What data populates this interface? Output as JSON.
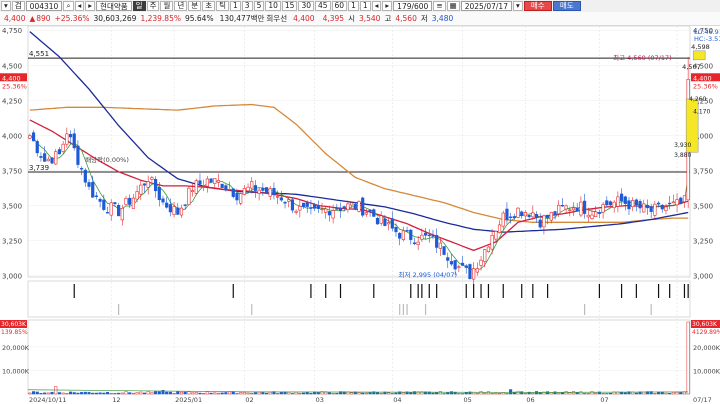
{
  "toolbar": {
    "stock_code": "004310",
    "stock_name": "현대약품",
    "period_buttons": [
      "주",
      "월",
      "년",
      "분",
      "초",
      "틱"
    ],
    "interval_buttons": [
      "1",
      "3",
      "5",
      "10",
      "15",
      "30",
      "45",
      "60"
    ],
    "extra_buttons": [
      "1",
      "1"
    ],
    "bar_count": "179/600",
    "date": "2025/07/17",
    "buy_label": "매수",
    "sell_label": "매도"
  },
  "info": {
    "price": "4,400",
    "change": "890",
    "change_pct": "+25.36%",
    "volume": "30,603,269",
    "volume_pct": "1,239.85%",
    "turnover": "95.64%",
    "amount": "130,477백만",
    "rotation_label": "회우선",
    "close_label": "4,400",
    "field2": "4,395",
    "open_label": "시",
    "open": "3,540",
    "high_label": "고",
    "high": "4,560",
    "low_label": "저",
    "low": "3,480"
  },
  "chart_data": {
    "type": "candlestick",
    "price_axis": {
      "ticks": [
        "4,750",
        "4,500",
        "4,250",
        "4,000",
        "3,750",
        "3,500",
        "3,250",
        "3,000"
      ],
      "range": [
        2990,
        4780
      ]
    },
    "volume_axis": {
      "ticks": [
        "20,000K",
        "10,000K"
      ],
      "range": [
        0,
        30603
      ]
    },
    "x_labels": [
      "2024/10/11",
      "12",
      "2025/01",
      "02",
      "03",
      "04",
      "05",
      "06",
      "07",
      "07/17"
    ],
    "horizontal_lines": [
      {
        "value": 4551,
        "label": "4,551"
      },
      {
        "value": 3739,
        "label": "3,739"
      }
    ],
    "annotations": {
      "high": "최고 4,560 (07/17)",
      "low": "최저 2,995 (04/07)",
      "dividend": "배당락(0.00%)",
      "high_value": "4,598",
      "high_value2": "4,507",
      "level_4260": "4,260",
      "level_4170": "4,170",
      "level_3930": "3,930",
      "level_3880": "3,880"
    },
    "right_labels": {
      "lc": "LC:46.91",
      "hc": "HC:-3.51",
      "price": "4,400",
      "pct": "25.36%",
      "vol": "30,603K",
      "vol_pct": "4129.89%"
    },
    "left_price_tag": "4,400",
    "left_pct_tag": "25.36%",
    "left_vol_tag": "30,603K",
    "left_vol_pct_tag": "139.85%",
    "anchors": [
      [
        0,
        4000
      ],
      [
        4,
        3820
      ],
      [
        8,
        3860
      ],
      [
        10,
        4030
      ],
      [
        13,
        3830
      ],
      [
        16,
        3620
      ],
      [
        20,
        3500
      ],
      [
        24,
        3460
      ],
      [
        28,
        3560
      ],
      [
        32,
        3700
      ],
      [
        36,
        3520
      ],
      [
        40,
        3450
      ],
      [
        44,
        3630
      ],
      [
        48,
        3680
      ],
      [
        52,
        3660
      ],
      [
        56,
        3580
      ],
      [
        60,
        3630
      ],
      [
        64,
        3600
      ],
      [
        68,
        3560
      ],
      [
        72,
        3480
      ],
      [
        76,
        3440
      ],
      [
        80,
        3470
      ],
      [
        84,
        3490
      ],
      [
        88,
        3500
      ],
      [
        92,
        3450
      ],
      [
        96,
        3360
      ],
      [
        100,
        3300
      ],
      [
        104,
        3270
      ],
      [
        108,
        3270
      ],
      [
        112,
        3180
      ],
      [
        116,
        3060
      ],
      [
        119,
        3010
      ],
      [
        122,
        3130
      ],
      [
        125,
        3300
      ],
      [
        128,
        3420
      ],
      [
        132,
        3470
      ],
      [
        136,
        3450
      ],
      [
        138,
        3390
      ],
      [
        141,
        3430
      ],
      [
        144,
        3480
      ],
      [
        148,
        3500
      ],
      [
        152,
        3460
      ],
      [
        156,
        3510
      ],
      [
        160,
        3530
      ],
      [
        164,
        3490
      ],
      [
        168,
        3460
      ],
      [
        172,
        3490
      ],
      [
        176,
        3510
      ],
      [
        178,
        3540
      ]
    ],
    "ma20_anchors": [
      [
        0,
        4110
      ],
      [
        6,
        4030
      ],
      [
        12,
        3930
      ],
      [
        18,
        3830
      ],
      [
        24,
        3740
      ],
      [
        30,
        3680
      ],
      [
        36,
        3640
      ],
      [
        42,
        3640
      ],
      [
        48,
        3630
      ],
      [
        54,
        3610
      ],
      [
        60,
        3600
      ],
      [
        66,
        3580
      ],
      [
        72,
        3550
      ],
      [
        78,
        3500
      ],
      [
        84,
        3480
      ],
      [
        90,
        3470
      ],
      [
        96,
        3420
      ],
      [
        102,
        3370
      ],
      [
        108,
        3300
      ],
      [
        114,
        3240
      ],
      [
        120,
        3180
      ],
      [
        126,
        3240
      ],
      [
        132,
        3380
      ],
      [
        138,
        3420
      ],
      [
        144,
        3440
      ],
      [
        150,
        3470
      ],
      [
        156,
        3490
      ],
      [
        162,
        3500
      ],
      [
        168,
        3490
      ],
      [
        174,
        3500
      ],
      [
        178,
        3530
      ]
    ],
    "ma60_anchors": [
      [
        0,
        4740
      ],
      [
        8,
        4560
      ],
      [
        16,
        4330
      ],
      [
        24,
        4070
      ],
      [
        32,
        3840
      ],
      [
        40,
        3690
      ],
      [
        48,
        3630
      ],
      [
        56,
        3600
      ],
      [
        64,
        3590
      ],
      [
        72,
        3580
      ],
      [
        80,
        3550
      ],
      [
        88,
        3520
      ],
      [
        96,
        3490
      ],
      [
        104,
        3440
      ],
      [
        112,
        3380
      ],
      [
        120,
        3330
      ],
      [
        128,
        3310
      ],
      [
        136,
        3320
      ],
      [
        144,
        3330
      ],
      [
        152,
        3350
      ],
      [
        160,
        3370
      ],
      [
        168,
        3400
      ],
      [
        176,
        3440
      ],
      [
        178,
        3450
      ]
    ],
    "ma120_anchors": [
      [
        0,
        4180
      ],
      [
        10,
        4200
      ],
      [
        20,
        4200
      ],
      [
        30,
        4190
      ],
      [
        40,
        4180
      ],
      [
        50,
        4210
      ],
      [
        60,
        4220
      ],
      [
        66,
        4200
      ],
      [
        72,
        4080
      ],
      [
        80,
        3870
      ],
      [
        88,
        3700
      ],
      [
        96,
        3620
      ],
      [
        104,
        3570
      ],
      [
        112,
        3520
      ],
      [
        120,
        3450
      ],
      [
        128,
        3400
      ],
      [
        136,
        3380
      ],
      [
        144,
        3380
      ],
      [
        152,
        3380
      ],
      [
        160,
        3380
      ],
      [
        168,
        3400
      ],
      [
        174,
        3410
      ],
      [
        178,
        3410
      ]
    ]
  }
}
